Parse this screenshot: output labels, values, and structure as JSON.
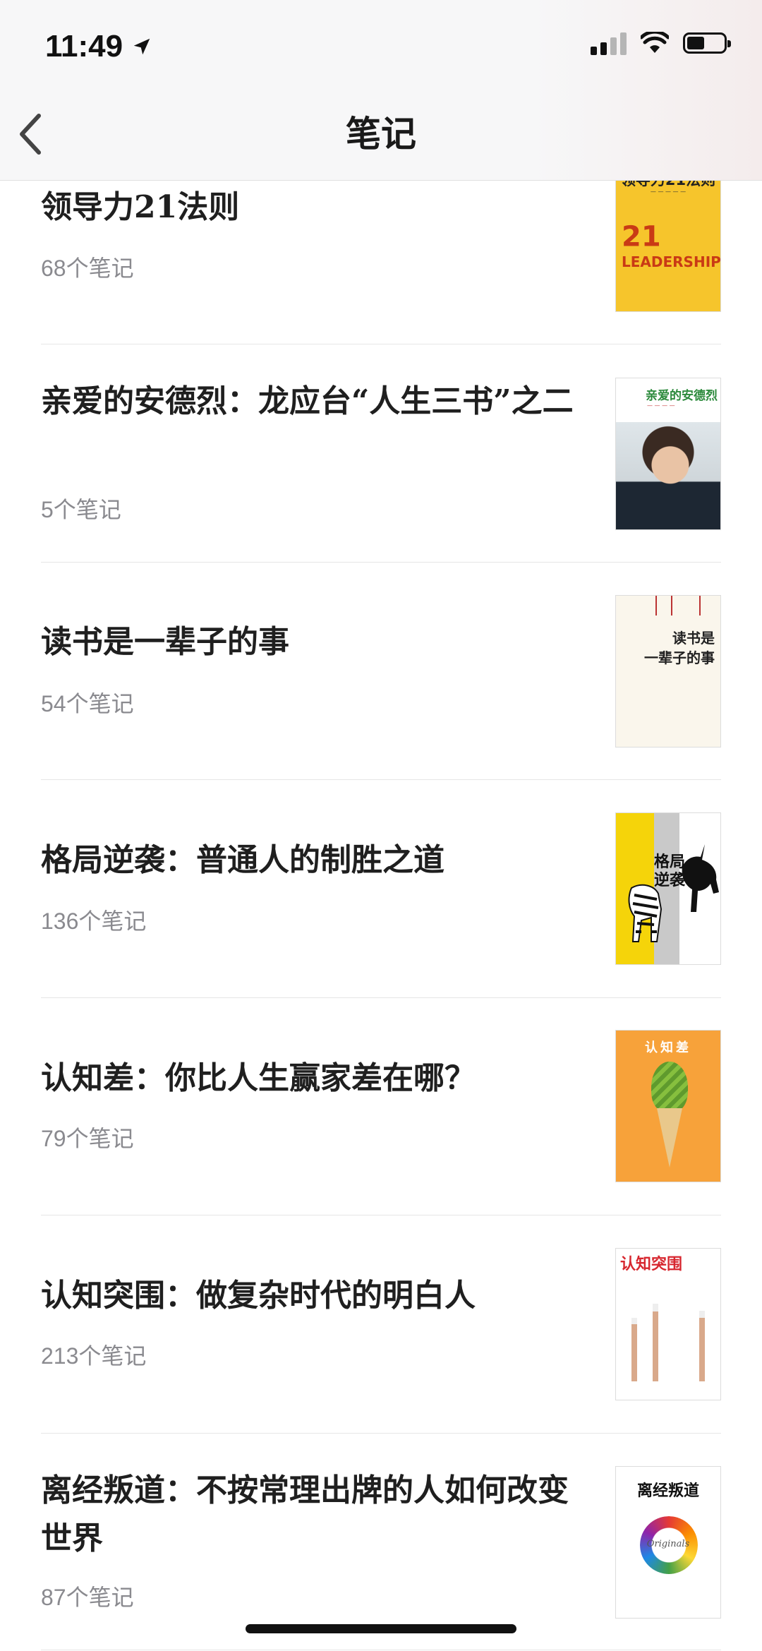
{
  "status_bar": {
    "time": "11:49"
  },
  "nav": {
    "title": "笔记"
  },
  "books": [
    {
      "title": "领导力21法则",
      "count": "68个笔记",
      "cover": "leadership-cover"
    },
    {
      "title": "亲爱的安德烈：龙应台“人生三书”之二",
      "count": "5个笔记",
      "cover": "andre-cover"
    },
    {
      "title": "读书是一辈子的事",
      "count": "54个笔记",
      "cover": "reading-cover"
    },
    {
      "title": "格局逆袭：普通人的制胜之道",
      "count": "136个笔记",
      "cover": "unicorn-cover"
    },
    {
      "title": "认知差：你比人生赢家差在哪？",
      "count": "79个笔记",
      "cover": "pineapple-cone-cover"
    },
    {
      "title": "认知突围：做复杂时代的明白人",
      "count": "213个笔记",
      "cover": "pencils-cover"
    },
    {
      "title": "离经叛道：不按常理出牌的人如何改变世界",
      "count": "87个笔记",
      "cover": "originals-cover"
    }
  ],
  "covers": {
    "c1_title": "领导力21法则",
    "c1_big": "21",
    "c1_lead": "LEADERSHIP",
    "c2_title": "亲爱的安德烈",
    "c3_title_1": "读书是",
    "c3_title_2": "一辈子的事",
    "c4_title_1": "格局",
    "c4_title_2": "逆袭",
    "c5_title": "认知差",
    "c6_title": "认知突围",
    "c7_title": "离经叛道",
    "c7_orig": "Originals"
  }
}
